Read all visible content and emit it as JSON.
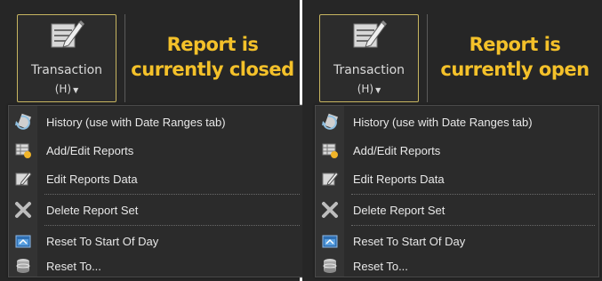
{
  "colors": {
    "panel_bg": "#262626",
    "menu_bg": "#2b2b2b",
    "status_text": "#f4c12a",
    "button_border": "#c7b560",
    "menu_text": "#e8e8e8"
  },
  "panels": [
    {
      "button": {
        "label": "Transaction",
        "shortcut": "(H)",
        "icon": "edit-document-icon"
      },
      "status_line1": "Report is",
      "status_line2": "currently closed",
      "menu": {
        "items": [
          {
            "label": "History (use with Date Ranges tab)",
            "icon": "history-icon"
          },
          {
            "label": "Add/Edit Reports",
            "icon": "add-edit-reports-icon"
          },
          {
            "label": "Edit Reports Data",
            "icon": "edit-data-icon"
          },
          {
            "label": "Delete Report Set",
            "icon": "delete-x-icon"
          },
          {
            "label": "Reset To Start Of Day",
            "icon": "reset-start-icon"
          },
          {
            "label": "Reset To...",
            "icon": "reset-database-icon"
          }
        ]
      }
    },
    {
      "button": {
        "label": "Transaction",
        "shortcut": "(H)",
        "icon": "edit-document-icon"
      },
      "status_line1": "Report is",
      "status_line2": "currently open",
      "menu": {
        "items": [
          {
            "label": "History (use with Date Ranges tab)",
            "icon": "history-icon"
          },
          {
            "label": "Add/Edit Reports",
            "icon": "add-edit-reports-icon"
          },
          {
            "label": "Edit Reports Data",
            "icon": "edit-data-icon"
          },
          {
            "label": "Delete Report Set",
            "icon": "delete-x-icon"
          },
          {
            "label": "Reset To Start Of Day",
            "icon": "reset-start-icon"
          },
          {
            "label": "Reset To...",
            "icon": "reset-database-icon"
          }
        ]
      }
    }
  ]
}
